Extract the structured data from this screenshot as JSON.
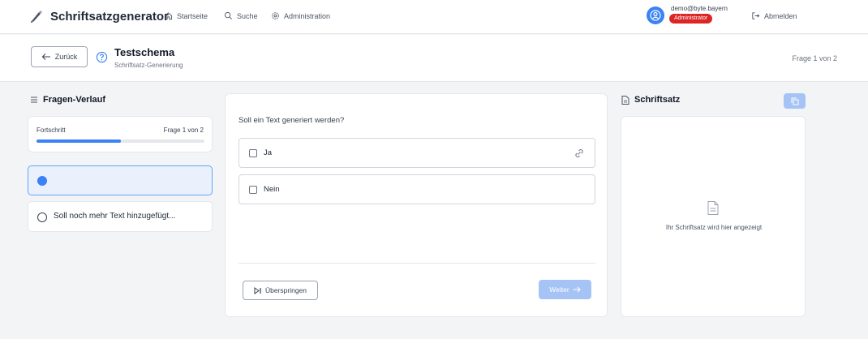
{
  "app": {
    "title": "Schriftsatzgenerator",
    "nav": [
      {
        "label": "Startseite",
        "icon": "home-icon"
      },
      {
        "label": "Suche",
        "icon": "search-icon"
      },
      {
        "label": "Administration",
        "icon": "gear-icon"
      }
    ],
    "user": {
      "email": "demo@byte.bayern",
      "role": "Administrator"
    },
    "logout_label": "Abmelden"
  },
  "subheader": {
    "back_label": "Zurück",
    "title": "Testschema",
    "subtitle": "Schriftsatz-Generierung",
    "progress_text": "Frage 1 von 2"
  },
  "history": {
    "title": "Fragen-Verlauf",
    "progress_label": "Fortschritt",
    "progress_count": "Frage 1 von 2",
    "progress_fraction": 0.5,
    "items": [
      {
        "label": "",
        "state": "current"
      },
      {
        "label": "Soll noch mehr Text hinzugefügt...",
        "state": "pending"
      }
    ]
  },
  "question": {
    "text": "Soll ein Text generiert werden?",
    "options": [
      {
        "label": "Ja",
        "checked": false,
        "has_link_icon": true
      },
      {
        "label": "Nein",
        "checked": false,
        "has_link_icon": false
      }
    ],
    "skip_label": "Überspringen",
    "next_label": "Weiter"
  },
  "preview": {
    "title": "Schriftsatz",
    "empty_text": "Ihr Schriftsatz wird hier angezeigt"
  },
  "colors": {
    "accent": "#3b82f6",
    "accent_light": "#a5c4f5",
    "danger": "#dc2626"
  }
}
